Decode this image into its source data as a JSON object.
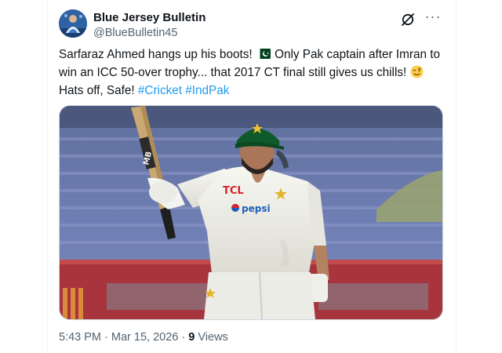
{
  "author": {
    "display_name": "Blue Jersey Bulletin",
    "handle": "@BlueBulletin45",
    "avatar_icon": "avatar-image"
  },
  "header": {
    "grok_icon": "grok-icon",
    "more_icon": "more-options-icon",
    "more_glyph": "···"
  },
  "tweet": {
    "text_part1": "Sarfaraz Ahmed hangs up his boots! ",
    "text_part2": " Only Pak captain after Imran to win an ICC 50-over trophy... that 2017 CT final still gives us chills! ",
    "text_part3": " Hats off, Safe! ",
    "hashtags": [
      "#Cricket",
      "#IndPak"
    ],
    "emojis": [
      "pakistan-flag-emoji",
      "winking-face-emoji"
    ]
  },
  "media": {
    "kind": "photo",
    "jersey_text_1": "TCL",
    "jersey_text_2": "pepsi",
    "bat_text": "MB"
  },
  "meta": {
    "time": "5:43 PM",
    "separator": "·",
    "date": "Mar 15, 2026",
    "views_count": "9",
    "views_label": "Views"
  },
  "colors": {
    "link": "#1d9bf0",
    "secondary_text": "#536471",
    "primary_text": "#0f1419",
    "border": "#cfd9de"
  }
}
